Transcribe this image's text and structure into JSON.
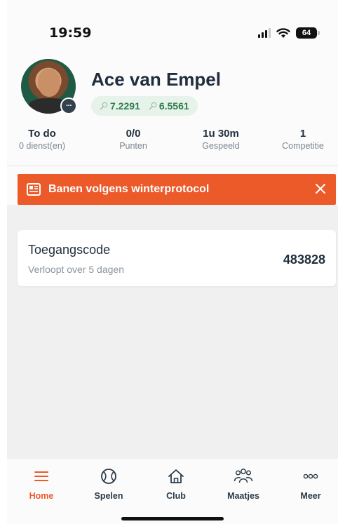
{
  "status_bar": {
    "time": "19:59",
    "battery": "64"
  },
  "profile": {
    "name": "Ace van Empel",
    "rating_singles": "7.2291",
    "rating_doubles": "6.5561",
    "avatar_more": "···"
  },
  "stats": [
    {
      "value": "To do",
      "label": "0 dienst(en)"
    },
    {
      "value": "0/0",
      "label": "Punten"
    },
    {
      "value": "1u 30m",
      "label": "Gespeeld"
    },
    {
      "value": "1",
      "label": "Competitie"
    }
  ],
  "banner": {
    "text": "Banen volgens winterprotocol",
    "color": "#ec5a2a"
  },
  "access_card": {
    "title": "Toegangscode",
    "subtitle": "Verloopt over 5 dagen",
    "code": "483828"
  },
  "tabbar": {
    "items": [
      {
        "label": "Home",
        "icon": "menu-icon",
        "active": true
      },
      {
        "label": "Spelen",
        "icon": "tennis-ball-icon"
      },
      {
        "label": "Club",
        "icon": "house-icon"
      },
      {
        "label": "Maatjes",
        "icon": "people-icon"
      },
      {
        "label": "Meer",
        "icon": "more-dots-icon"
      }
    ]
  },
  "colors": {
    "accent": "#ec5a2a",
    "rating_green": "#2e7d4f"
  }
}
